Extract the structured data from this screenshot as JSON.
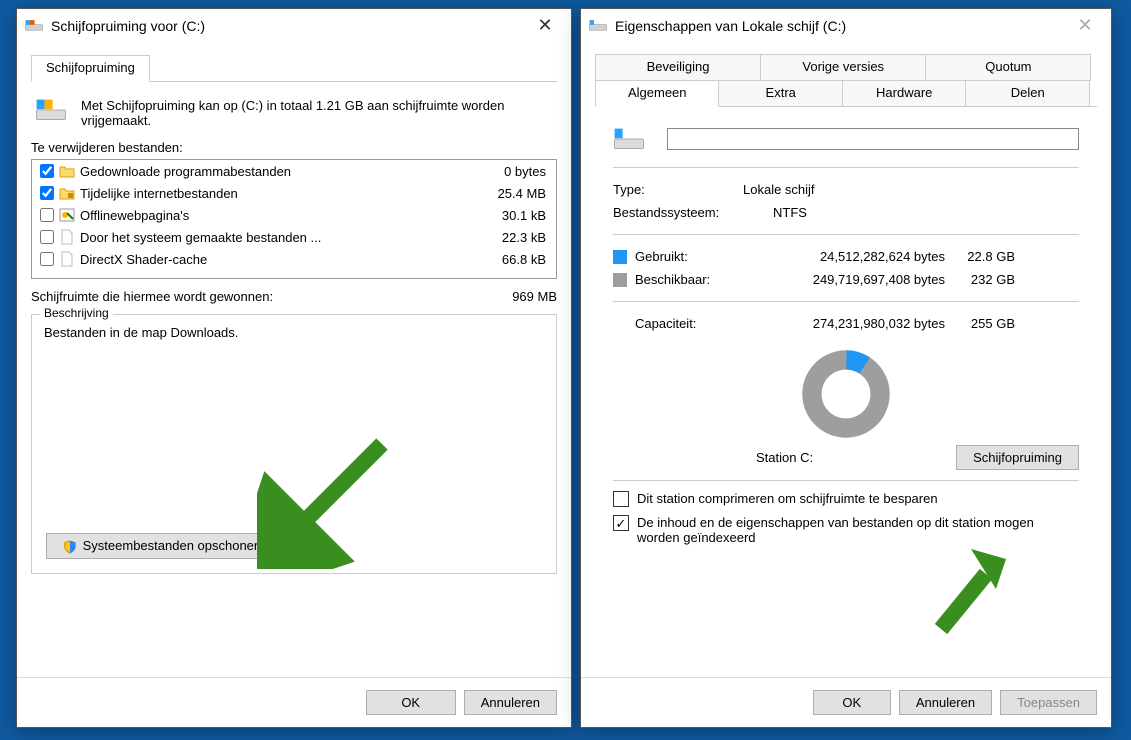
{
  "left": {
    "title": "Schijfopruiming voor  (C:)",
    "tab": "Schijfopruiming",
    "intro": "Met Schijfopruiming kan op  (C:) in totaal 1.21 GB aan schijfruimte worden vrijgemaakt.",
    "files_label": "Te verwijderen bestanden:",
    "files": [
      {
        "checked": true,
        "icon": "folder",
        "name": "Gedownloade programmabestanden",
        "size": "0 bytes"
      },
      {
        "checked": true,
        "icon": "folder-lock",
        "name": "Tijdelijke internetbestanden",
        "size": "25.4 MB"
      },
      {
        "checked": false,
        "icon": "web-offline",
        "name": "Offlinewebpagina's",
        "size": "30.1 kB"
      },
      {
        "checked": false,
        "icon": "file",
        "name": "Door het systeem gemaakte bestanden ...",
        "size": "22.3 kB"
      },
      {
        "checked": false,
        "icon": "file",
        "name": "DirectX Shader-cache",
        "size": "66.8 kB"
      }
    ],
    "gain_label": "Schijfruimte die hiermee wordt gewonnen:",
    "gain_value": "969 MB",
    "desc_legend": "Beschrijving",
    "desc_body": "Bestanden in de map Downloads.",
    "sysbtn": "Systeembestanden opschonen",
    "ok": "OK",
    "cancel": "Annuleren"
  },
  "right": {
    "title": "Eigenschappen van Lokale schijf (C:)",
    "tabs_row1": [
      "Beveiliging",
      "Vorige versies",
      "Quotum"
    ],
    "tabs_row2": [
      "Algemeen",
      "Extra",
      "Hardware",
      "Delen"
    ],
    "active_tab": "Algemeen",
    "name_value": "",
    "type_label": "Type:",
    "type_value": "Lokale schijf",
    "fs_label": "Bestandssysteem:",
    "fs_value": "NTFS",
    "used_label": "Gebruikt:",
    "used_bytes": "24,512,282,624 bytes",
    "used_gb": "22.8 GB",
    "used_color": "#2196f3",
    "free_label": "Beschikbaar:",
    "free_bytes": "249,719,697,408 bytes",
    "free_gb": "232 GB",
    "free_color": "#9e9e9e",
    "cap_label": "Capaciteit:",
    "cap_bytes": "274,231,980,032 bytes",
    "cap_gb": "255 GB",
    "station_label": "Station C:",
    "cleanup_btn": "Schijfopruiming",
    "opt1": "Dit station comprimeren om schijfruimte te besparen",
    "opt1_checked": false,
    "opt2": "De inhoud en de eigenschappen van bestanden op dit station mogen worden geïndexeerd",
    "opt2_checked": true,
    "ok": "OK",
    "cancel": "Annuleren",
    "apply": "Toepassen"
  },
  "chart_data": {
    "type": "pie",
    "title": "Station C:",
    "series": [
      {
        "name": "Gebruikt",
        "bytes": 24512282624,
        "gb": 22.8,
        "color": "#2196f3"
      },
      {
        "name": "Beschikbaar",
        "bytes": 249719697408,
        "gb": 232,
        "color": "#9e9e9e"
      }
    ],
    "capacity_bytes": 274231980032,
    "capacity_gb": 255
  }
}
